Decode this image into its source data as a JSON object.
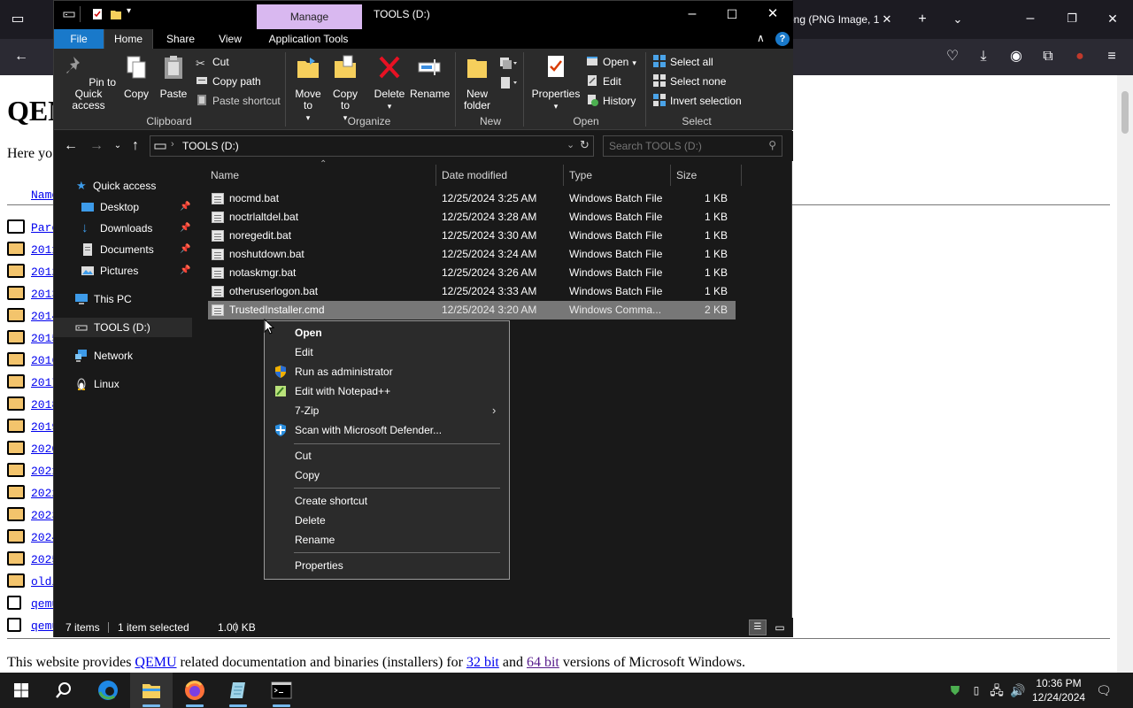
{
  "browser": {
    "tab_title": "png (PNG Image, 1",
    "page_title": "QEMU",
    "intro_text": "Here yo",
    "name_header": "Name",
    "dir_links": [
      "Parent Directory",
      "2011/",
      "2012/",
      "2013/",
      "2014/",
      "2015/",
      "2016/",
      "2017/",
      "2018/",
      "2019/",
      "2020/",
      "2021/",
      "2022/",
      "2023/",
      "2024/",
      "2025/",
      "old/",
      "qemu",
      "qemu"
    ],
    "footer": {
      "prefix": "This website provides ",
      "qemu": "QEMU",
      "middle": " related documentation and binaries (installers) for ",
      "bit32": "32 bit",
      "and": " and ",
      "bit64": "64 bit",
      "suffix": " versions of Microsoft Windows."
    }
  },
  "explorer": {
    "title": "TOOLS (D:)",
    "manage_tab": "Manage",
    "ribbon_tabs": [
      "File",
      "Home",
      "Share",
      "View",
      "Application Tools"
    ],
    "ribbon": {
      "pin": "Pin to Quick access",
      "copy": "Copy",
      "paste": "Paste",
      "cut": "Cut",
      "copy_path": "Copy path",
      "paste_shortcut": "Paste shortcut",
      "move_to": "Move to",
      "copy_to": "Copy to",
      "delete": "Delete",
      "rename": "Rename",
      "new_folder": "New folder",
      "properties": "Properties",
      "open": "Open",
      "edit": "Edit",
      "history": "History",
      "select_all": "Select all",
      "select_none": "Select none",
      "invert_selection": "Invert selection",
      "groups": [
        "Clipboard",
        "Organize",
        "New",
        "Open",
        "Select"
      ]
    },
    "address_path": "TOOLS (D:)",
    "search_placeholder": "Search TOOLS (D:)",
    "nav": {
      "quick_access": "Quick access",
      "desktop": "Desktop",
      "downloads": "Downloads",
      "documents": "Documents",
      "pictures": "Pictures",
      "this_pc": "This PC",
      "tools": "TOOLS (D:)",
      "network": "Network",
      "linux": "Linux"
    },
    "columns": [
      "Name",
      "Date modified",
      "Type",
      "Size"
    ],
    "files": [
      {
        "name": "nocmd.bat",
        "date": "12/25/2024 3:25 AM",
        "type": "Windows Batch File",
        "size": "1 KB"
      },
      {
        "name": "noctrlaltdel.bat",
        "date": "12/25/2024 3:28 AM",
        "type": "Windows Batch File",
        "size": "1 KB"
      },
      {
        "name": "noregedit.bat",
        "date": "12/25/2024 3:30 AM",
        "type": "Windows Batch File",
        "size": "1 KB"
      },
      {
        "name": "noshutdown.bat",
        "date": "12/25/2024 3:24 AM",
        "type": "Windows Batch File",
        "size": "1 KB"
      },
      {
        "name": "notaskmgr.bat",
        "date": "12/25/2024 3:26 AM",
        "type": "Windows Batch File",
        "size": "1 KB"
      },
      {
        "name": "otheruserlogon.bat",
        "date": "12/25/2024 3:33 AM",
        "type": "Windows Batch File",
        "size": "1 KB"
      },
      {
        "name": "TrustedInstaller.cmd",
        "date": "12/25/2024 3:20 AM",
        "type": "Windows Comma...",
        "size": "2 KB"
      }
    ],
    "status": {
      "items": "7 items",
      "selected": "1 item selected",
      "size": "1.00 KB"
    }
  },
  "context_menu": {
    "open": "Open",
    "edit": "Edit",
    "run_admin": "Run as administrator",
    "notepadpp": "Edit with Notepad++",
    "sevenzip": "7-Zip",
    "defender": "Scan with Microsoft Defender...",
    "cut": "Cut",
    "copy": "Copy",
    "create_shortcut": "Create shortcut",
    "delete": "Delete",
    "rename": "Rename",
    "properties": "Properties"
  },
  "taskbar": {
    "time": "10:36 PM",
    "date": "12/24/2024"
  },
  "colors": {
    "explorer_bg": "#191919",
    "ribbon_bg": "#2b2b2b",
    "file_tab": "#1979ca",
    "manage_tab": "#d9b8f0",
    "selection": "#777777",
    "link": "#0000ee"
  }
}
